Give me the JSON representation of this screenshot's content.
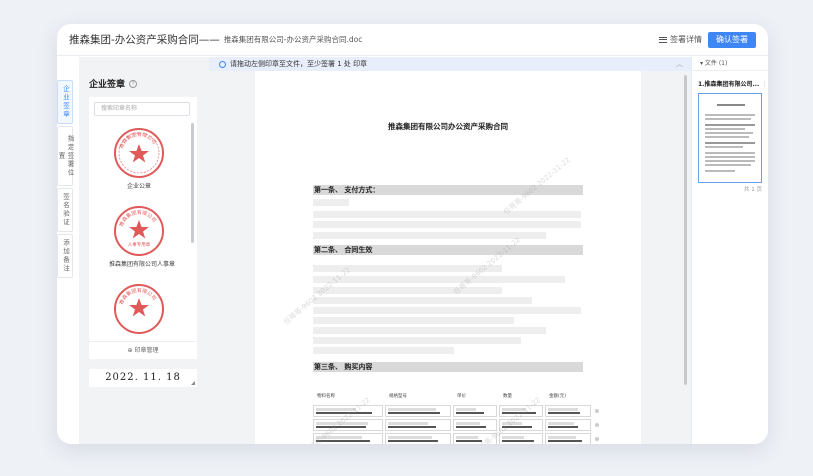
{
  "header": {
    "title": "推森集团-办公资产采购合同——",
    "filename": "推森集团有限公司-办公资产采购合同.doc",
    "detail_label": "签署详情",
    "confirm_label": "确认签署"
  },
  "vertical_tabs": [
    "企业签章",
    "指定签署位置",
    "签名验证",
    "添加备注"
  ],
  "left_panel": {
    "title": "企业签章",
    "search_placeholder": "搜索印章名称",
    "seals": [
      {
        "label": "企业公章",
        "text_top": "推森集团有限公司",
        "text_bottom": "",
        "color": "#e05a5a"
      },
      {
        "label": "推森集团有限公司人事章",
        "text_top": "推森集团有限公司",
        "text_bottom": "人事专用章",
        "color": "#e05a5a"
      }
    ],
    "manage_label": "⊕ 印章管理",
    "date": "2022. 11. 18"
  },
  "document": {
    "hint": "请拖动左侧印章至文件，至少签署 1 处 印章",
    "title": "推森集团有限公司办公资产采购合同",
    "sections": [
      "第一条、    支付方式：",
      "第二条、    合同生效",
      "第三条、    购买内容"
    ],
    "table_headers": [
      "物料名称",
      "规格型号",
      "单价",
      "数量",
      "金额(元)"
    ],
    "watermark": "任哥哥-9602 2022-11-22"
  },
  "right_panel": {
    "files_label": "文件 (1)",
    "file_name": "1.推森集团有限公司...",
    "page_count": "共 1 页"
  }
}
